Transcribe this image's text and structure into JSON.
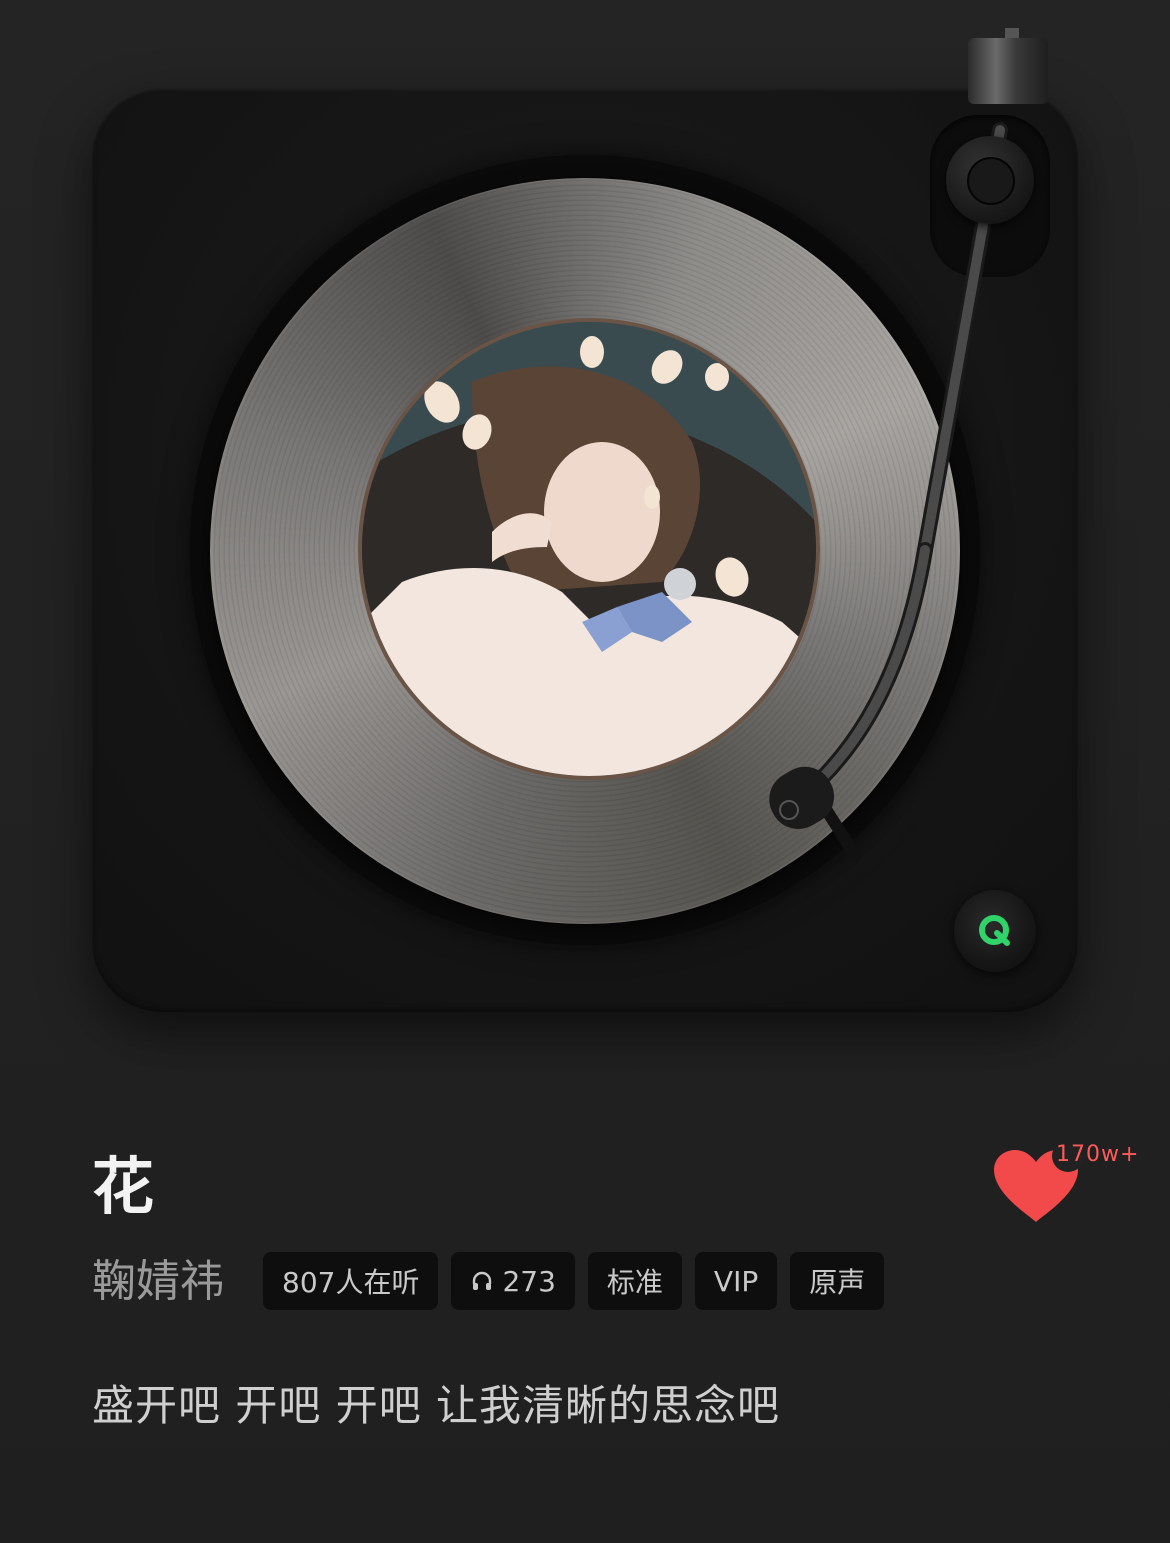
{
  "player": {
    "song_title": "花",
    "artist": "鞠婧祎",
    "tags": {
      "listeners": "807人在听",
      "plays": "273",
      "quality": "标准",
      "vip": "VIP",
      "version": "原声"
    },
    "like_count": "170w+",
    "lyric_line": "盛开吧 开吧 开吧 让我清晰的思念吧",
    "icons": {
      "headphones": "headphones-icon",
      "heart": "heart-icon",
      "logo": "qq-music-logo-icon"
    },
    "colors": {
      "background": "#222222",
      "heart": "#f24a4a",
      "logo_green": "#2fd36a",
      "tag_bg": "#0e0e0e"
    }
  }
}
